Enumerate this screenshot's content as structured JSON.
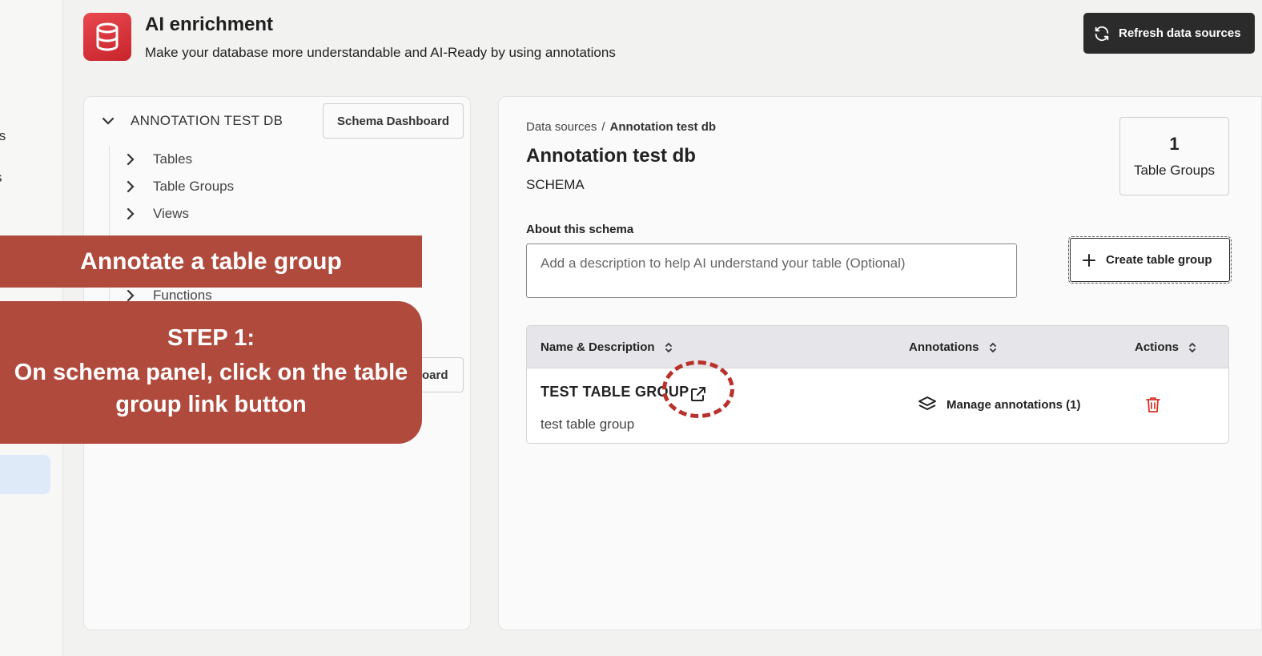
{
  "header": {
    "title": "AI enrichment",
    "subtitle": "Make your database more understandable and AI-Ready by using annotations",
    "refresh_label": "Refresh data sources",
    "logo_icon": "database-icon"
  },
  "nav": {
    "fragment_1": "ts",
    "fragment_2": "s"
  },
  "schema_panel": {
    "db_name": "ANNOTATION TEST DB",
    "dashboard_label": "Schema Dashboard",
    "dashboard_label_2": "oard",
    "items": [
      {
        "label": "Tables"
      },
      {
        "label": "Table Groups"
      },
      {
        "label": "Views"
      },
      {
        "label": "Functions"
      }
    ]
  },
  "detail": {
    "breadcrumb_root": "Data sources",
    "breadcrumb_sep": "/",
    "breadcrumb_current": "Annotation test db",
    "title": "Annotation test db",
    "kind": "SCHEMA",
    "stat_value": "1",
    "stat_label": "Table Groups",
    "about_label": "About this schema",
    "about_placeholder": "Add a description to help AI understand your table (Optional)",
    "create_label": "Create table group",
    "table": {
      "columns": [
        "Name & Description",
        "Annotations",
        "Actions"
      ],
      "rows": [
        {
          "name": "TEST TABLE GROUP",
          "description": "test table group",
          "annotations_label": "Manage annotations (1)"
        }
      ]
    }
  },
  "overlay": {
    "banner": "Annotate a table group",
    "step_title": "STEP 1:",
    "step_text": "On schema panel, click on the table group link button"
  },
  "colors": {
    "overlay": "#b04a3d",
    "logo": "#d8343c",
    "delete": "#d9342b",
    "dark_button": "#2b2b2b"
  }
}
